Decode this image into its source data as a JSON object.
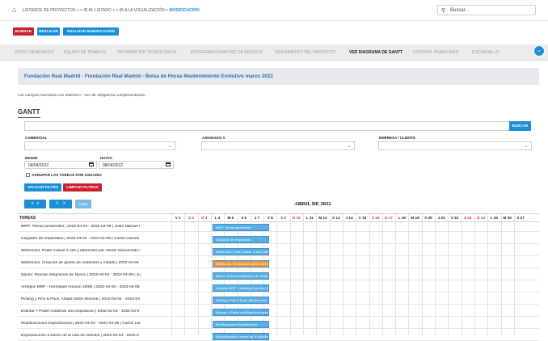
{
  "breadcrumb": {
    "home_icon": "home-icon",
    "trail": "LISTADOS DE PROYECTOS  < < IR AL LISTADO  < < IR A LA VISUALIZACIÓN  >",
    "current": "MODIFICACIÓN"
  },
  "search": {
    "placeholder": "Buscar...",
    "icon": "search-icon"
  },
  "actions": {
    "borrar": "BORRAR",
    "replicar": "REPLICAR",
    "realizar": "REALIZAR MODIFICACIÓN"
  },
  "tabs": [
    {
      "label": "DATOS GENERALES"
    },
    {
      "label": "EQUIPO DE TRABAJO"
    },
    {
      "label": "INFORMACIÓN TECNOLÓGICA"
    },
    {
      "label": "ENTREGABLES/MATRIZ DE RIESGOS"
    },
    {
      "label": "SEGUIMIENTO DEL PROYECTO"
    },
    {
      "label": "VER DIAGRAMA DE GANTT"
    },
    {
      "label": "CONTROL FINANCIERO"
    },
    {
      "label": "ESCANDALLO"
    }
  ],
  "project_title": "Fundación Real Madrid - Fundación Real Madrid - Bolsa de Horas Mantenimiento Evolutivo marzo 2022",
  "required_note": "Los campos marcados con asterisco * son de obligatoria cumplimentación.",
  "gantt": {
    "heading": "GANTT",
    "buscar": "BUSCAR",
    "labels": {
      "comercial": "COMERCIAL",
      "asignado": "ASIGNADO A",
      "empresa": "EMPRESA / CLIENTE",
      "desde": "DESDE",
      "hasta": "HASTA"
    },
    "desde_value": "04/04/2022",
    "hasta_value": "08/04/2022",
    "agrupar": "AGRUPAR LAS TAREAS POR USUARIO",
    "aplicar": "APLICAR FILTRO",
    "limpiar": "LIMPIAR FILTROS",
    "nav": {
      "first": "«",
      "prev_fast": "»",
      "prev": "<",
      "next": ">",
      "today": "today"
    },
    "month": "ABRIL DE 2022",
    "tasks_header": "TAREAS",
    "days": [
      {
        "label": "V 1",
        "weekend": false
      },
      {
        "label": "S 2",
        "weekend": true
      },
      {
        "label": "D 3",
        "weekend": true
      },
      {
        "label": "L 4",
        "weekend": false
      },
      {
        "label": "M 5",
        "weekend": false
      },
      {
        "label": "X 6",
        "weekend": false
      },
      {
        "label": "J 7",
        "weekend": false
      },
      {
        "label": "V 8",
        "weekend": false
      },
      {
        "label": "S 9",
        "weekend": true
      },
      {
        "label": "D 10",
        "weekend": true
      },
      {
        "label": "L 11",
        "weekend": false
      },
      {
        "label": "M 12",
        "weekend": false
      },
      {
        "label": "X 13",
        "weekend": false
      },
      {
        "label": "J 14",
        "weekend": false
      },
      {
        "label": "V 15",
        "weekend": false
      },
      {
        "label": "S 16",
        "weekend": true
      },
      {
        "label": "D 17",
        "weekend": true
      },
      {
        "label": "L 18",
        "weekend": false
      },
      {
        "label": "M 19",
        "weekend": false
      },
      {
        "label": "X 20",
        "weekend": false
      },
      {
        "label": "J 21",
        "weekend": false
      },
      {
        "label": "V 22",
        "weekend": false
      },
      {
        "label": "S 23",
        "weekend": true
      },
      {
        "label": "D 24",
        "weekend": true
      },
      {
        "label": "L 25",
        "weekend": false
      },
      {
        "label": "M 26",
        "weekend": false
      },
      {
        "label": "X 27",
        "weekend": false
      }
    ],
    "tasks": [
      {
        "text": "MRP: Temas pendientes | 2022-04-04 - 2022-04-09 | Justo Manuel I",
        "bar": "MRP: Temas pendientes",
        "color": "#5aaee3"
      },
      {
        "text": "Cargador de empleados | 2022-04-04 - 2022-04-09 | Carlos Llamas",
        "bar": "Cargador de empleados",
        "color": "#5aaee3"
      },
      {
        "text": "Webhooks: Poder indicar 2 urls y diferentes por cliente relacionado I",
        "bar": "Webhooks: Poder indicar 2 urls y diferen",
        "color": "#5aaee3"
      },
      {
        "text": "Webhooks: Creación de gestor de reintentos y estado | 2022-04-04",
        "bar": "Webhooks: Creación de gestor de reinte",
        "color": "#f0963c"
      },
      {
        "text": "Nacex: Revisar integración de Nacex | 2022-04-04 - 2022-04-09 | Ju",
        "bar": "Nacex: Revisar integración de Nacex",
        "color": "#5aaee3"
      },
      {
        "text": "Arreglos MRP - Hermepiel reunión 29/06 | 2022-04-04 - 2022-04-09",
        "bar": "Arreglos MRP - Hermepiel reunión 29/06",
        "color": "#5aaee3"
      },
      {
        "text": "Picking y Pick & Pack: Añadir botón eliminar | 2022-04-04 - 2022-04",
        "bar": "Picking y Pick & Pack: Añadir botón elim",
        "color": "#5aaee3"
      },
      {
        "text": "Estimar > Poder modificar una expedición | 2022-04-04 - 2022-04-0",
        "bar": "Estimar > Poder modificar una expedició",
        "color": "#5aaee3"
      },
      {
        "text": "Modificaciones Expediciones | 2022-04-04 - 2022-04-09 | Carlos Lla",
        "bar": "Modificaciones Expediciones",
        "color": "#5aaee3"
      },
      {
        "text": "Exportaciones a través de la cola de eventos | 2022-04-04 - 2022-0",
        "bar": "Exportaciones a través de la cola de eve",
        "color": "#5aaee3"
      }
    ]
  }
}
